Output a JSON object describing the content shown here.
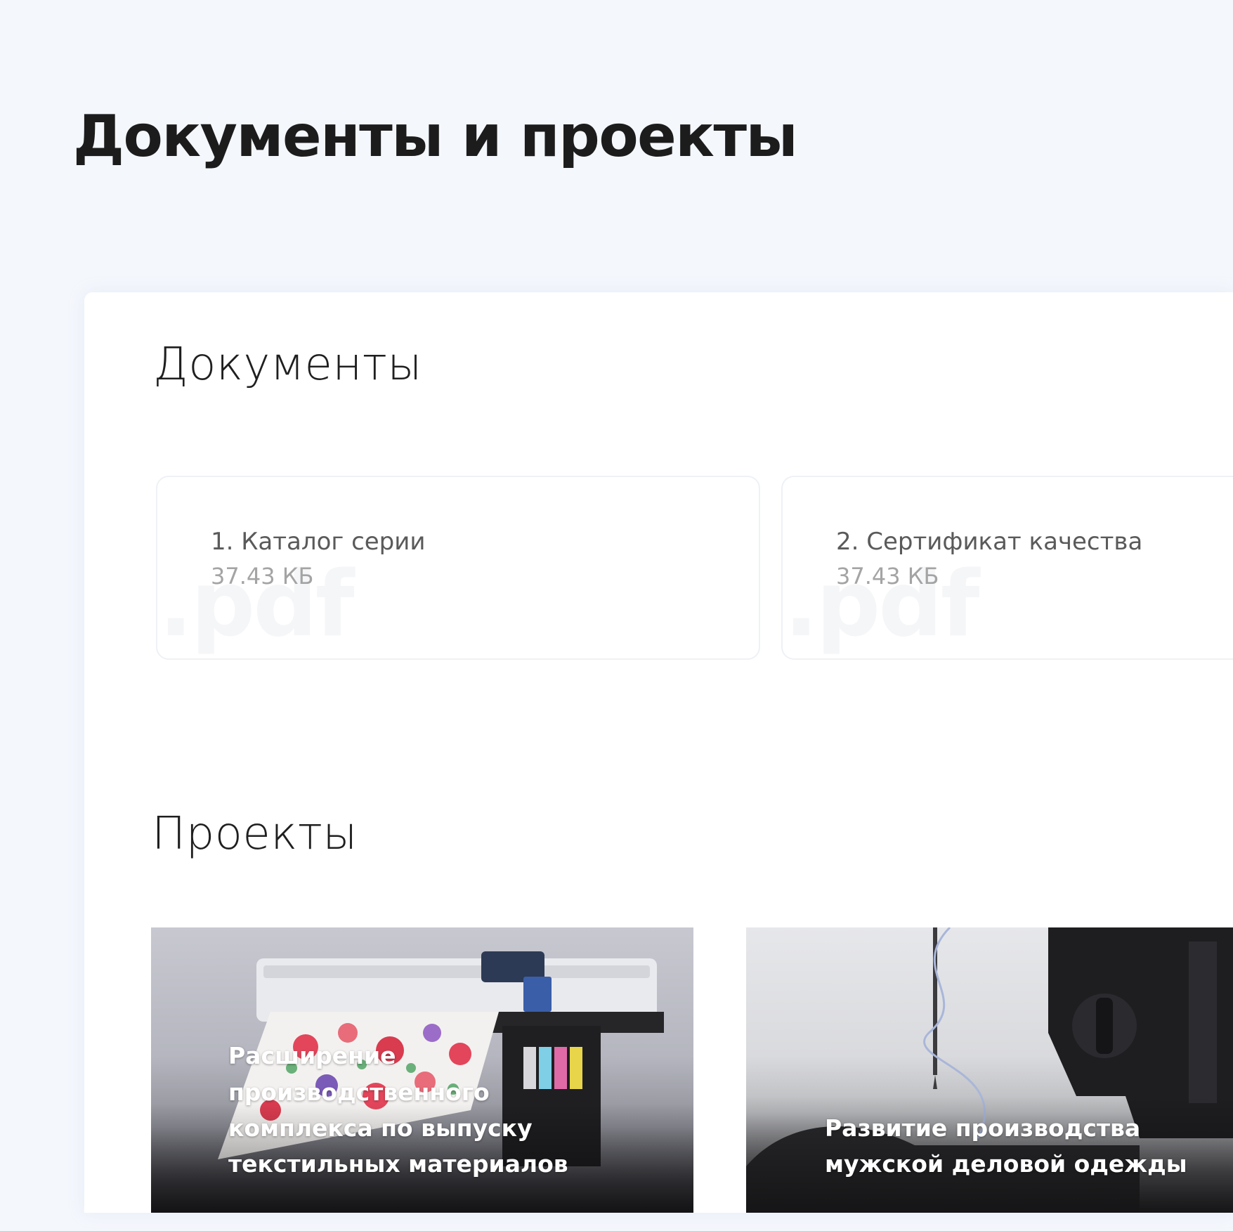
{
  "page": {
    "title": "Документы и проекты"
  },
  "documents": {
    "title": "Документы",
    "items": [
      {
        "name": "1. Каталог серии",
        "size": "37.43 КБ",
        "ext": ".pdf"
      },
      {
        "name": "2. Сертификат качества",
        "size": "37.43 КБ",
        "ext": ".pdf"
      }
    ]
  },
  "projects": {
    "title": "Проекты",
    "items": [
      {
        "title_lines": [
          "Расширение",
          "производственного",
          "комплекса по выпуску",
          "текстильных материалов"
        ]
      },
      {
        "title_lines": [
          "Развитие производства",
          "мужской деловой одежды"
        ]
      }
    ]
  }
}
